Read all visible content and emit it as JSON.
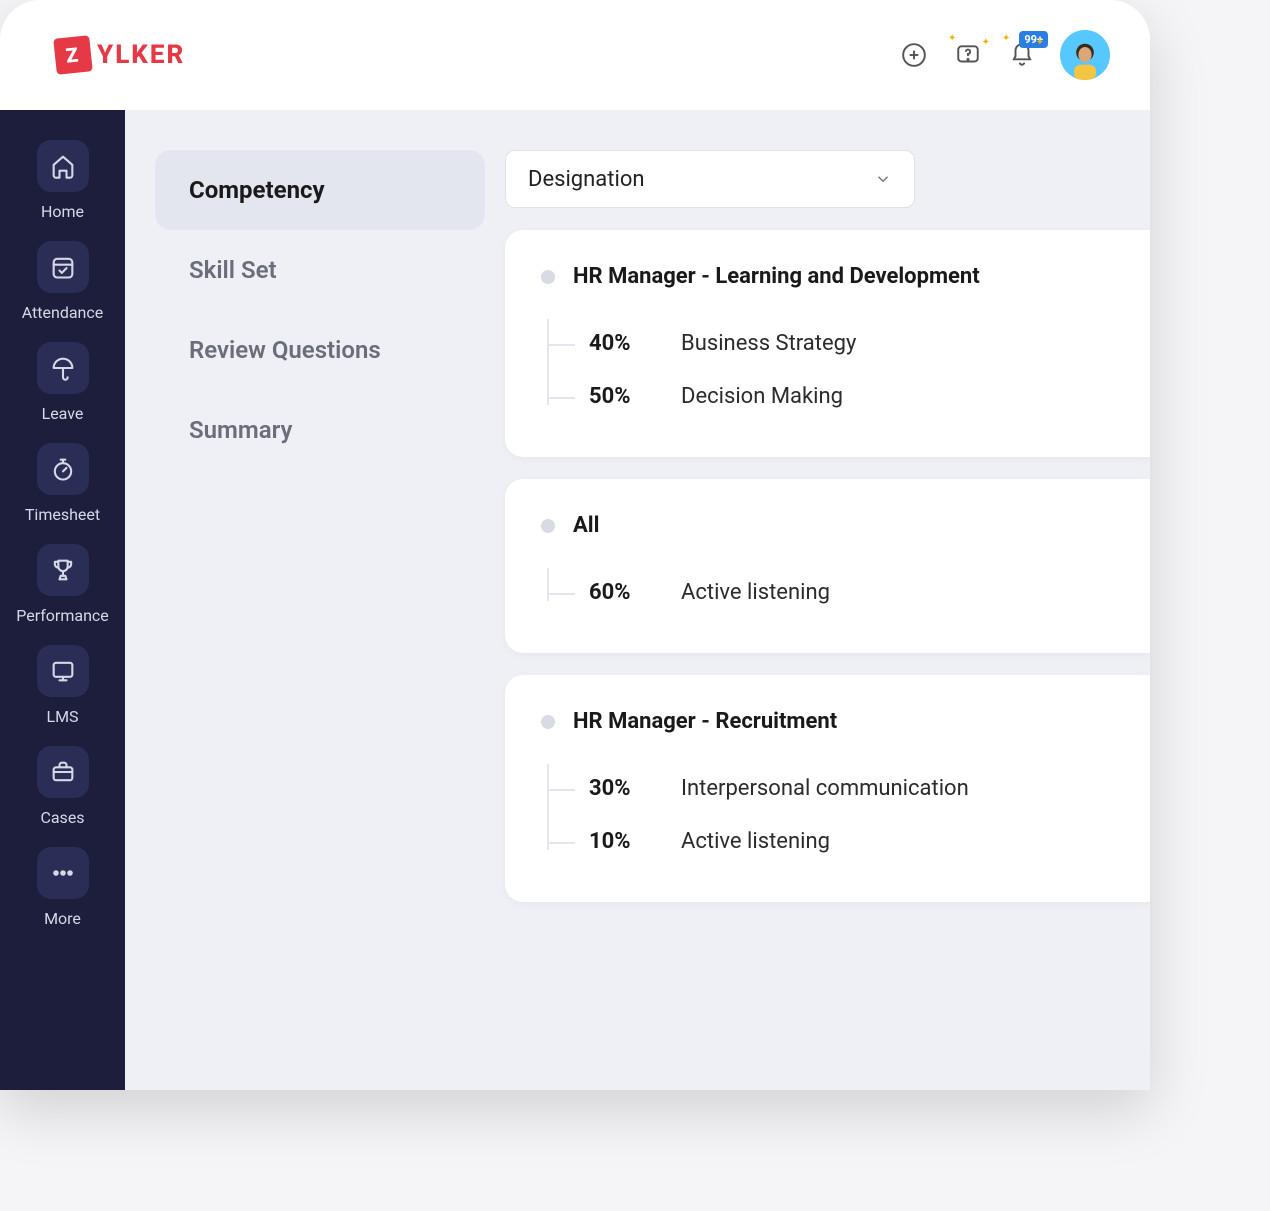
{
  "brand": {
    "badge_letter": "Z",
    "name": "YLKER"
  },
  "topbar": {
    "notification_badge": "99+"
  },
  "sidebar": {
    "items": [
      {
        "label": "Home"
      },
      {
        "label": "Attendance"
      },
      {
        "label": "Leave"
      },
      {
        "label": "Timesheet"
      },
      {
        "label": "Performance"
      },
      {
        "label": "LMS"
      },
      {
        "label": "Cases"
      },
      {
        "label": "More"
      }
    ]
  },
  "tabs": [
    {
      "label": "Competency",
      "active": true
    },
    {
      "label": "Skill Set"
    },
    {
      "label": "Review Questions"
    },
    {
      "label": "Summary"
    }
  ],
  "dropdown": {
    "selected": "Designation"
  },
  "groups": [
    {
      "title": "HR Manager - Learning and Development",
      "items": [
        {
          "pct": "40%",
          "label": "Business Strategy"
        },
        {
          "pct": "50%",
          "label": "Decision Making"
        }
      ]
    },
    {
      "title": "All",
      "items": [
        {
          "pct": "60%",
          "label": "Active listening"
        }
      ]
    },
    {
      "title": "HR Manager - Recruitment",
      "items": [
        {
          "pct": "30%",
          "label": "Interpersonal communication"
        },
        {
          "pct": "10%",
          "label": "Active listening"
        }
      ]
    }
  ]
}
